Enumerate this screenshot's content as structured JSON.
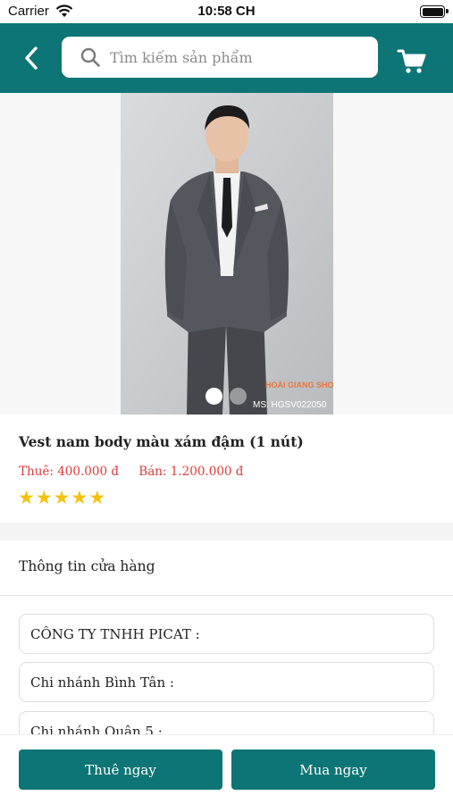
{
  "status_bar": {
    "carrier": "Carrier",
    "time": "10:58 CH"
  },
  "header": {
    "search_placeholder": "Tìm kiếm sản phẩm"
  },
  "product": {
    "image_code": "MS: HGSV022050",
    "watermark": "HOÀI GIANG SHOP",
    "name": "Vest nam body màu xám đậm (1 nút)",
    "rent_price": "Thuê: 400.000 đ",
    "buy_price": "Bán: 1.200.000 đ",
    "rating": 5,
    "image_count": 2,
    "active_image_index": 0
  },
  "store": {
    "title": "Thông tin cửa hàng",
    "branches": [
      "CÔNG TY TNHH PICAT :",
      "Chi nhánh Bình Tân :",
      "Chi nhánh Quận 5 :"
    ]
  },
  "actions": {
    "rent_label": "Thuê ngay",
    "buy_label": "Mua ngay"
  },
  "colors": {
    "brand": "#0d7575",
    "price": "#e03a3a",
    "star": "#f4c20d"
  }
}
